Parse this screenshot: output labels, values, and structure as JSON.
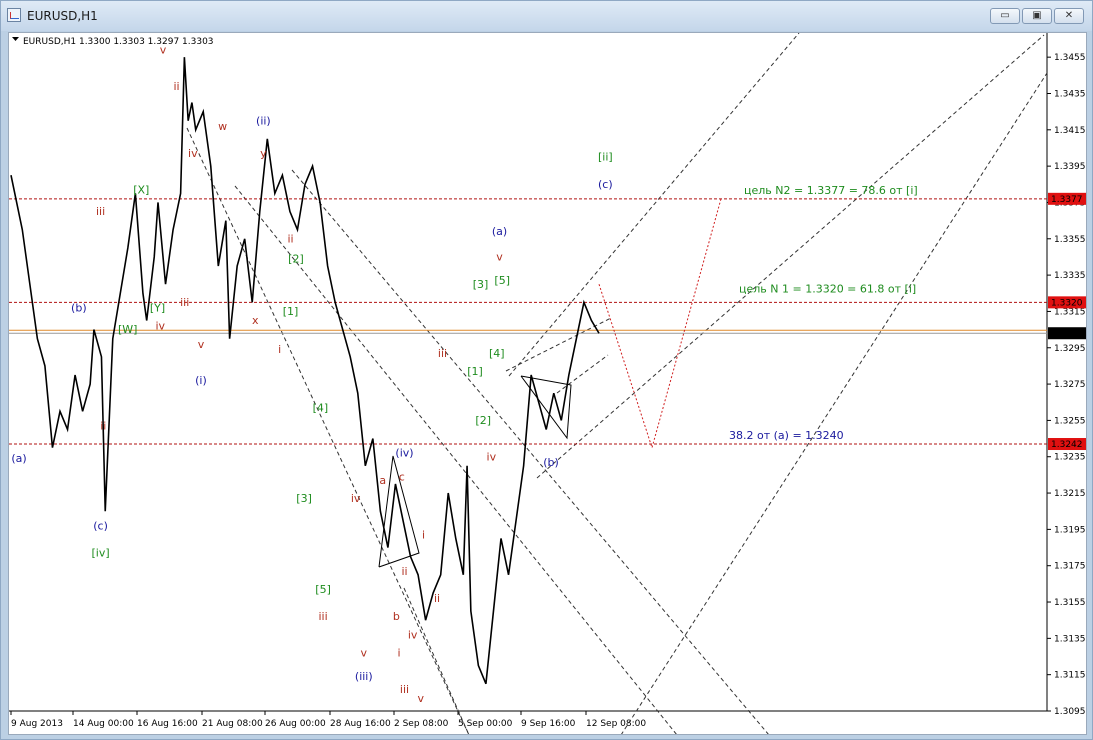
{
  "window": {
    "title": "EURUSD,H1",
    "buttons": [
      "minimize",
      "maximize",
      "close"
    ]
  },
  "chart_header": "EURUSD,H1  1.3300 1.3303 1.3297 1.3303",
  "chart_data": {
    "type": "line",
    "symbol": "EURUSD",
    "timeframe": "H1",
    "ohlc": {
      "open": 1.33,
      "high": 1.3303,
      "low": 1.3297,
      "close": 1.3303
    },
    "ylim": [
      1.3095,
      1.3465
    ],
    "y_ticks": [
      "1.3455",
      "1.3435",
      "1.3415",
      "1.3395",
      "1.3375",
      "1.3355",
      "1.3335",
      "1.3315",
      "1.3295",
      "1.3275",
      "1.3255",
      "1.3235",
      "1.3215",
      "1.3195",
      "1.3175",
      "1.3155",
      "1.3135",
      "1.3115",
      "1.3095"
    ],
    "x_ticks": [
      "9 Aug 2013",
      "14 Aug 00:00",
      "16 Aug 16:00",
      "21 Aug 08:00",
      "26 Aug 00:00",
      "28 Aug 16:00",
      "2 Sep 08:00",
      "5 Sep 00:00",
      "9 Sep 16:00",
      "12 Sep 08:00"
    ],
    "current_price": "1.3303",
    "levels": [
      {
        "price": 1.3377,
        "tag": "1.3377",
        "text": "цель N2 = 1.3377 =  78.6 от [i]",
        "text_color": "#1e8c1e"
      },
      {
        "price": 1.332,
        "tag": "1.3320",
        "text": "цель N 1 = 1.3320 = 61.8 от [i]",
        "text_color": "#1e8c1e"
      },
      {
        "price": 1.3242,
        "tag": "1.3242",
        "text": "38.2 от (a) = 1.3240",
        "text_color": "#1a1a9e"
      }
    ],
    "price_path": [
      [
        0,
        1.339
      ],
      [
        3,
        1.336
      ],
      [
        5,
        1.333
      ],
      [
        7,
        1.33
      ],
      [
        9,
        1.3285
      ],
      [
        11,
        1.324
      ],
      [
        13,
        1.326
      ],
      [
        15,
        1.325
      ],
      [
        17,
        1.328
      ],
      [
        19,
        1.326
      ],
      [
        21,
        1.3275
      ],
      [
        22,
        1.3305
      ],
      [
        24,
        1.329
      ],
      [
        25,
        1.3205
      ],
      [
        27,
        1.33
      ],
      [
        29,
        1.3325
      ],
      [
        31,
        1.335
      ],
      [
        33,
        1.338
      ],
      [
        35,
        1.3325
      ],
      [
        36,
        1.331
      ],
      [
        38,
        1.3345
      ],
      [
        39,
        1.3375
      ],
      [
        41,
        1.333
      ],
      [
        43,
        1.336
      ],
      [
        45,
        1.338
      ],
      [
        46,
        1.3455
      ],
      [
        47,
        1.342
      ],
      [
        48,
        1.343
      ],
      [
        49,
        1.3415
      ],
      [
        51,
        1.3425
      ],
      [
        53,
        1.3395
      ],
      [
        55,
        1.334
      ],
      [
        57,
        1.3365
      ],
      [
        58,
        1.33
      ],
      [
        60,
        1.334
      ],
      [
        62,
        1.3355
      ],
      [
        64,
        1.332
      ],
      [
        66,
        1.337
      ],
      [
        68,
        1.341
      ],
      [
        70,
        1.338
      ],
      [
        72,
        1.339
      ],
      [
        74,
        1.337
      ],
      [
        76,
        1.336
      ],
      [
        78,
        1.3385
      ],
      [
        80,
        1.3395
      ],
      [
        82,
        1.3375
      ],
      [
        84,
        1.334
      ],
      [
        86,
        1.332
      ],
      [
        88,
        1.3305
      ],
      [
        90,
        1.329
      ],
      [
        92,
        1.327
      ],
      [
        94,
        1.323
      ],
      [
        96,
        1.3245
      ],
      [
        98,
        1.3205
      ],
      [
        100,
        1.3185
      ],
      [
        102,
        1.322
      ],
      [
        104,
        1.32
      ],
      [
        106,
        1.318
      ],
      [
        108,
        1.317
      ],
      [
        110,
        1.3145
      ],
      [
        112,
        1.316
      ],
      [
        114,
        1.317
      ],
      [
        116,
        1.3215
      ],
      [
        118,
        1.319
      ],
      [
        120,
        1.317
      ],
      [
        121,
        1.323
      ],
      [
        122,
        1.315
      ],
      [
        124,
        1.312
      ],
      [
        126,
        1.311
      ],
      [
        128,
        1.315
      ],
      [
        130,
        1.319
      ],
      [
        132,
        1.317
      ],
      [
        134,
        1.32
      ],
      [
        136,
        1.323
      ],
      [
        138,
        1.328
      ],
      [
        140,
        1.3265
      ],
      [
        142,
        1.325
      ],
      [
        144,
        1.327
      ],
      [
        146,
        1.3255
      ],
      [
        148,
        1.328
      ],
      [
        150,
        1.33
      ],
      [
        152,
        1.332
      ],
      [
        154,
        1.331
      ],
      [
        156,
        1.3303
      ]
    ],
    "wave_labels": [
      {
        "t": "(a)",
        "price": 1.3232,
        "day": -0.5,
        "c": "#1a1a9e"
      },
      {
        "t": "(b)",
        "price": 1.3315,
        "day": 2.5,
        "c": "#1a1a9e"
      },
      {
        "t": "(c)",
        "price": 1.3195,
        "day": 3.3,
        "c": "#1a1a9e"
      },
      {
        "t": "[iv]",
        "price": 1.318,
        "day": 3.3,
        "c": "#1e8c1e"
      },
      {
        "t": "iii",
        "price": 1.3368,
        "day": 3.3,
        "c": "#b03020"
      },
      {
        "t": "ii",
        "price": 1.325,
        "day": 3.4,
        "c": "#b03020"
      },
      {
        "t": "[W]",
        "price": 1.3303,
        "day": 4.3,
        "c": "#1e8c1e"
      },
      {
        "t": "[X]",
        "price": 1.338,
        "day": 4.8,
        "c": "#1e8c1e"
      },
      {
        "t": "[Y]",
        "price": 1.3315,
        "day": 5.4,
        "c": "#1e8c1e"
      },
      {
        "t": "iv",
        "price": 1.3305,
        "day": 5.5,
        "c": "#b03020"
      },
      {
        "t": "v",
        "price": 1.3457,
        "day": 5.6,
        "c": "#b03020"
      },
      {
        "t": "ii",
        "price": 1.3437,
        "day": 6.1,
        "c": "#b03020"
      },
      {
        "t": "iv",
        "price": 1.34,
        "day": 6.7,
        "c": "#b03020"
      },
      {
        "t": "iii",
        "price": 1.3318,
        "day": 6.4,
        "c": "#b03020"
      },
      {
        "t": "v",
        "price": 1.3295,
        "day": 7.0,
        "c": "#b03020"
      },
      {
        "t": "(i)",
        "price": 1.3275,
        "day": 7.0,
        "c": "#1a1a9e"
      },
      {
        "t": "w",
        "price": 1.3415,
        "day": 7.8,
        "c": "#b03020"
      },
      {
        "t": "x",
        "price": 1.3308,
        "day": 9.0,
        "c": "#b03020"
      },
      {
        "t": "(ii)",
        "price": 1.3418,
        "day": 9.3,
        "c": "#1a1a9e"
      },
      {
        "t": "y",
        "price": 1.34,
        "day": 9.3,
        "c": "#b03020"
      },
      {
        "t": "ii",
        "price": 1.3353,
        "day": 10.3,
        "c": "#b03020"
      },
      {
        "t": "[2]",
        "price": 1.3342,
        "day": 10.5,
        "c": "#1e8c1e"
      },
      {
        "t": "[1]",
        "price": 1.3313,
        "day": 10.3,
        "c": "#1e8c1e"
      },
      {
        "t": "i",
        "price": 1.3292,
        "day": 9.9,
        "c": "#b03020"
      },
      {
        "t": "[4]",
        "price": 1.326,
        "day": 11.4,
        "c": "#1e8c1e"
      },
      {
        "t": "[3]",
        "price": 1.321,
        "day": 10.8,
        "c": "#1e8c1e"
      },
      {
        "t": "iv",
        "price": 1.321,
        "day": 12.7,
        "c": "#b03020"
      },
      {
        "t": "[5]",
        "price": 1.316,
        "day": 11.5,
        "c": "#1e8c1e"
      },
      {
        "t": "iii",
        "price": 1.3145,
        "day": 11.5,
        "c": "#b03020"
      },
      {
        "t": "v",
        "price": 1.3125,
        "day": 13.0,
        "c": "#b03020"
      },
      {
        "t": "(iii)",
        "price": 1.3112,
        "day": 13.0,
        "c": "#1a1a9e"
      },
      {
        "t": "a",
        "price": 1.322,
        "day": 13.7,
        "c": "#b03020"
      },
      {
        "t": "(iv)",
        "price": 1.3235,
        "day": 14.5,
        "c": "#1a1a9e"
      },
      {
        "t": "c",
        "price": 1.3222,
        "day": 14.4,
        "c": "#b03020"
      },
      {
        "t": "b",
        "price": 1.3145,
        "day": 14.2,
        "c": "#b03020"
      },
      {
        "t": "ii",
        "price": 1.317,
        "day": 14.5,
        "c": "#b03020"
      },
      {
        "t": "i",
        "price": 1.319,
        "day": 15.2,
        "c": "#b03020"
      },
      {
        "t": "iv",
        "price": 1.3135,
        "day": 14.8,
        "c": "#b03020"
      },
      {
        "t": "i",
        "price": 1.3125,
        "day": 14.3,
        "c": "#b03020"
      },
      {
        "t": "iii",
        "price": 1.3105,
        "day": 14.5,
        "c": "#b03020"
      },
      {
        "t": "v",
        "price": 1.31,
        "day": 15.1,
        "c": "#b03020"
      },
      {
        "t": "ii",
        "price": 1.3155,
        "day": 15.7,
        "c": "#b03020"
      },
      {
        "t": "iii",
        "price": 1.329,
        "day": 15.9,
        "c": "#b03020"
      },
      {
        "t": "[1]",
        "price": 1.328,
        "day": 17.1,
        "c": "#1e8c1e"
      },
      {
        "t": "[2]",
        "price": 1.3253,
        "day": 17.4,
        "c": "#1e8c1e"
      },
      {
        "t": "iv",
        "price": 1.3233,
        "day": 17.7,
        "c": "#b03020"
      },
      {
        "t": "[3]",
        "price": 1.3328,
        "day": 17.3,
        "c": "#1e8c1e"
      },
      {
        "t": "[4]",
        "price": 1.329,
        "day": 17.9,
        "c": "#1e8c1e"
      },
      {
        "t": "[5]",
        "price": 1.333,
        "day": 18.1,
        "c": "#1e8c1e"
      },
      {
        "t": "(a)",
        "price": 1.3357,
        "day": 18.0,
        "c": "#1a1a9e"
      },
      {
        "t": "v",
        "price": 1.3343,
        "day": 18.0,
        "c": "#b03020"
      },
      {
        "t": "(b)",
        "price": 1.323,
        "day": 19.9,
        "c": "#1a1a9e"
      },
      {
        "t": "(c)",
        "price": 1.3383,
        "day": 21.9,
        "c": "#1a1a9e"
      },
      {
        "t": "[ii]",
        "price": 1.3398,
        "day": 21.9,
        "c": "#1e8c1e"
      }
    ],
    "grid": false,
    "legend": "none"
  }
}
